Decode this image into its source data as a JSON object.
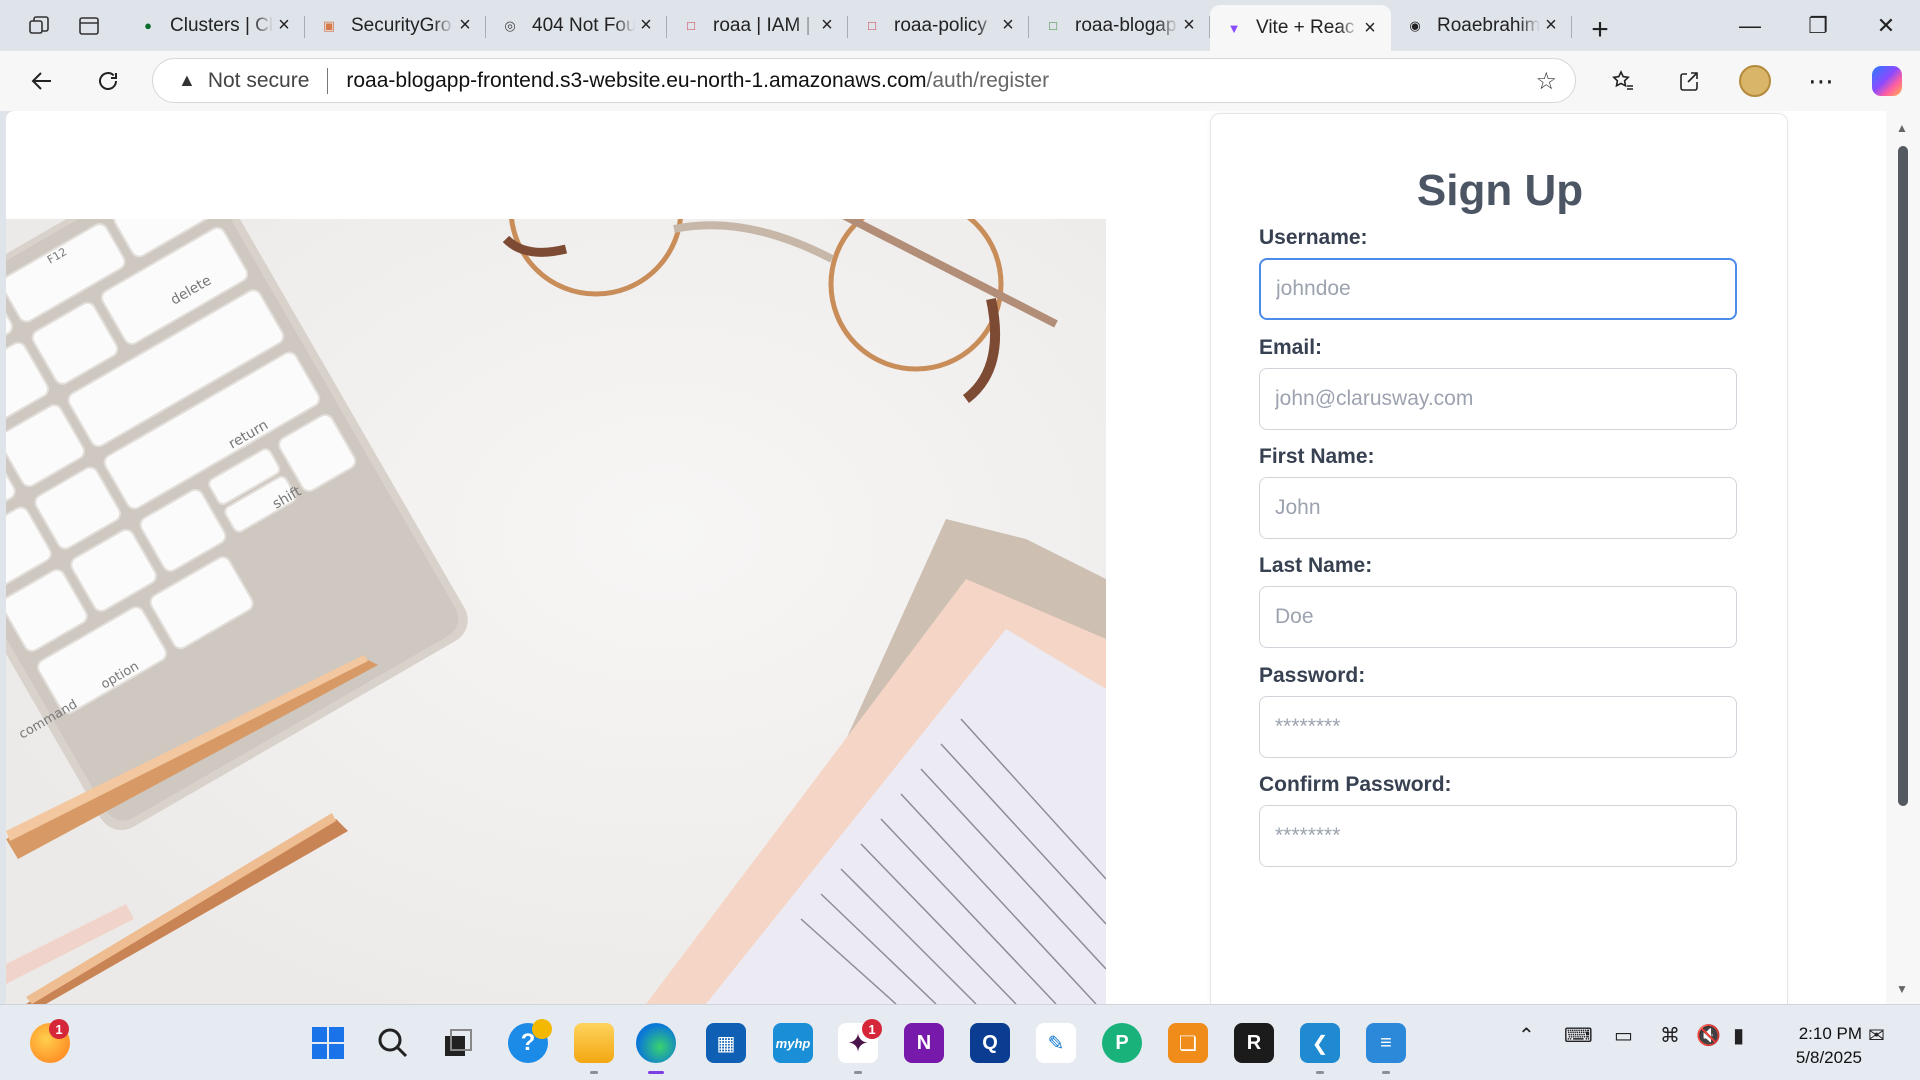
{
  "browser": {
    "tabs": [
      {
        "title": "Clusters | Cl",
        "favicon": "mongodb-leaf-icon",
        "active": false
      },
      {
        "title": "SecurityGro",
        "favicon": "aws-security-icon",
        "active": false
      },
      {
        "title": "404 Not Fou",
        "favicon": "globe-icon",
        "active": false
      },
      {
        "title": "roaa | IAM |",
        "favicon": "aws-iam-icon",
        "active": false
      },
      {
        "title": "roaa-policy",
        "favicon": "aws-iam-icon",
        "active": false
      },
      {
        "title": "roaa-blogap",
        "favicon": "aws-s3-icon",
        "active": false
      },
      {
        "title": "Vite + Reac",
        "favicon": "vite-icon",
        "active": true
      },
      {
        "title": "Roaebrahim",
        "favicon": "github-icon",
        "active": false
      }
    ],
    "address": {
      "security_label": "Not secure",
      "host": "roaa-blogapp-frontend.s3-website.eu-north-1.amazonaws.com",
      "path": "/auth/register"
    }
  },
  "page": {
    "heading": "Sign Up",
    "fields": [
      {
        "label": "Username:",
        "placeholder": "johndoe",
        "type": "text",
        "focused": true
      },
      {
        "label": "Email:",
        "placeholder": "john@clarusway.com",
        "type": "email",
        "focused": false
      },
      {
        "label": "First Name:",
        "placeholder": "John",
        "type": "text",
        "focused": false
      },
      {
        "label": "Last Name:",
        "placeholder": "Doe",
        "type": "text",
        "focused": false
      },
      {
        "label": "Password:",
        "placeholder": "********",
        "type": "password",
        "focused": false
      },
      {
        "label": "Confirm Password:",
        "placeholder": "********",
        "type": "password",
        "focused": false
      }
    ],
    "hero_image": {
      "keyboard_keys": [
        "delete",
        "return",
        "shift",
        "option",
        "command",
        "F12"
      ]
    }
  },
  "taskbar": {
    "start_badge": "1",
    "slack_badge": "1",
    "hp_label": "myhp",
    "clock": {
      "time": "2:10 PM",
      "date": "5/8/2025"
    }
  },
  "colors": {
    "focus": "#4c8be8",
    "heading": "#4b5563",
    "badge": "#d6263a"
  }
}
